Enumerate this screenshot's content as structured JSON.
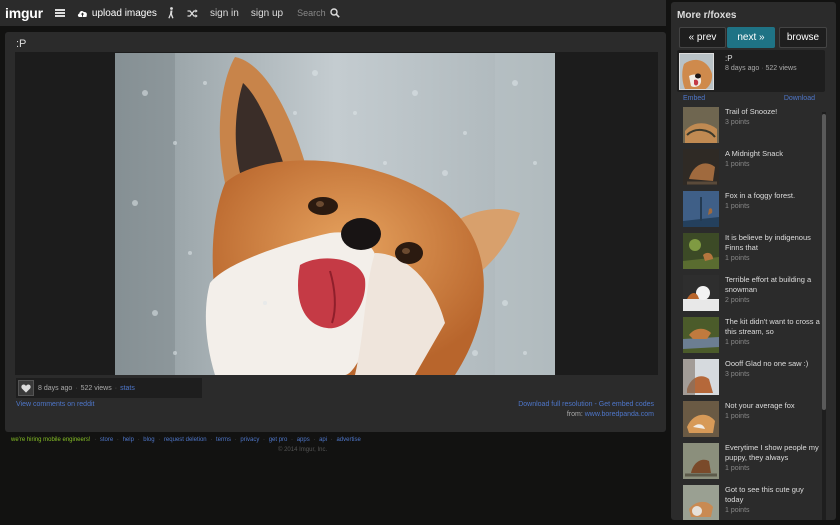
{
  "topbar": {
    "logo": "imgur",
    "upload_label": "upload images",
    "sign_in": "sign in",
    "sign_up": "sign up",
    "search_placeholder": "Search"
  },
  "post": {
    "title": ":P",
    "age": "8 days ago",
    "views": "522 views",
    "stats": "stats",
    "comments_link": "View comments on reddit",
    "download_link": "Download full resolution - Get embed codes",
    "source_prefix": "from:",
    "source_link": "www.boredpanda.com"
  },
  "footer": {
    "hiring": "we're hiring mobile engineers!",
    "links": [
      "store",
      "help",
      "blog",
      "request deletion",
      "terms",
      "privacy",
      "get pro",
      "apps",
      "api",
      "advertise"
    ],
    "copyright": "© 2014 Imgur, Inc."
  },
  "sidebar": {
    "title": "More r/foxes",
    "prev": "« prev",
    "next": "next »",
    "browse": "browse",
    "current": {
      "title": ":P",
      "age": "8 days ago",
      "views": "522 views"
    },
    "embed": "Embed",
    "download": "Download",
    "items": [
      {
        "title": "Trail of Snooze!",
        "points": "3 points"
      },
      {
        "title": "A Midnight Snack",
        "points": "1 points"
      },
      {
        "title": "Fox in a foggy forest.",
        "points": "1 points"
      },
      {
        "title": "It is believe by indigenous Finns that",
        "points": "1 points"
      },
      {
        "title": "Terrible effort at building a snowman",
        "points": "2 points"
      },
      {
        "title": "The kit didn't want to cross a this stream, so",
        "points": "1 points"
      },
      {
        "title": "Oooff Glad no one saw :)",
        "points": "3 points"
      },
      {
        "title": "Not your average fox",
        "points": "1 points"
      },
      {
        "title": "Everytime I show people my puppy, they always",
        "points": "1 points"
      },
      {
        "title": "Got to see this cute guy today",
        "points": "1 points"
      }
    ]
  },
  "colors": {
    "accent": "#1f7385",
    "link": "#4e76c9",
    "hiring": "#85bf25",
    "panel": "#2b2b2b",
    "background": "#121211"
  }
}
